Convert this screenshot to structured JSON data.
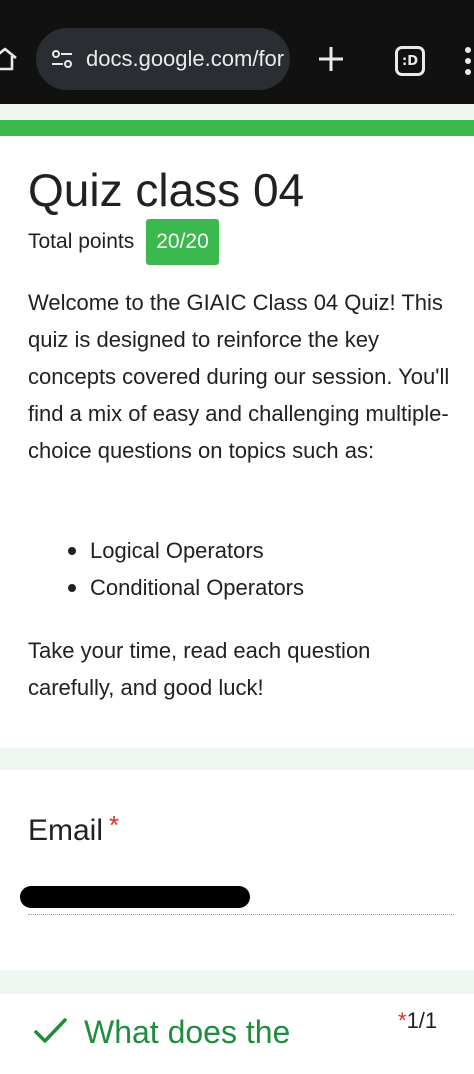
{
  "browser": {
    "url": "docs.google.com/for",
    "tab_count": ":D"
  },
  "form": {
    "title": "Quiz class 04",
    "total_points_label": "Total points",
    "total_points_value": "20/20",
    "description": "Welcome to the GIAIC Class 04 Quiz! This quiz is designed to reinforce the key concepts covered during our session. You'll find a mix of easy and challenging multiple-choice questions on topics such as:",
    "topics": [
      "Logical Operators",
      "Conditional Operators"
    ],
    "outro": "Take your time, read each question carefully, and good luck!"
  },
  "email": {
    "label": "Email",
    "required_mark": "*"
  },
  "next_question": {
    "text": "What does the",
    "required_mark": "*",
    "score": "1/1"
  },
  "colors": {
    "accent_green": "#3bb84e",
    "correct_green": "#1e8e3e",
    "required_red": "#d93025",
    "browser_bar": "#111111"
  },
  "icons": {
    "home": "home-icon",
    "site_info": "tune-icon",
    "new_tab": "plus-icon",
    "tabs": "tab-switcher-icon",
    "menu": "more-vert-icon",
    "correct": "checkmark-icon"
  }
}
